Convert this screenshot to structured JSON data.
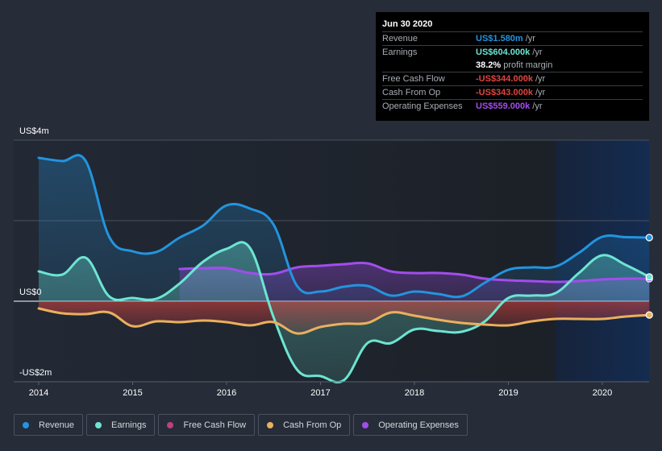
{
  "tooltip": {
    "date": "Jun 30 2020",
    "rows": [
      {
        "label": "Revenue",
        "value": "US$1.580m",
        "unit": "/yr",
        "color": "#2394df"
      },
      {
        "label": "Earnings",
        "value": "US$604.000k",
        "unit": "/yr",
        "color": "#6ce5d2"
      },
      {
        "label": "",
        "value": "38.2%",
        "unit": "profit margin",
        "color": "#ffffff"
      },
      {
        "label": "Free Cash Flow",
        "value": "-US$344.000k",
        "unit": "/yr",
        "color": "#e0453f"
      },
      {
        "label": "Cash From Op",
        "value": "-US$343.000k",
        "unit": "/yr",
        "color": "#e0453f"
      },
      {
        "label": "Operating Expenses",
        "value": "US$559.000k",
        "unit": "/yr",
        "color": "#a24ded"
      }
    ]
  },
  "legend": [
    {
      "label": "Revenue",
      "color": "#2394df"
    },
    {
      "label": "Earnings",
      "color": "#6ce5d2"
    },
    {
      "label": "Free Cash Flow",
      "color": "#c0407e"
    },
    {
      "label": "Cash From Op",
      "color": "#eab05e"
    },
    {
      "label": "Operating Expenses",
      "color": "#a24ded"
    }
  ],
  "chart_data": {
    "type": "area",
    "title": "",
    "xlabel": "",
    "ylabel": "",
    "y_unit": "US$ millions",
    "ylim": [
      -2,
      4
    ],
    "xlim": [
      2014.0,
      2020.5
    ],
    "y_tick_labels": [
      {
        "value": 4,
        "label": "US$4m"
      },
      {
        "value": 0,
        "label": "US$0"
      },
      {
        "value": -2,
        "label": "-US$2m"
      }
    ],
    "gridlines_at": [
      4,
      2,
      0
    ],
    "x_ticks": [
      {
        "value": 2014,
        "label": "2014"
      },
      {
        "value": 2015,
        "label": "2015"
      },
      {
        "value": 2016,
        "label": "2016"
      },
      {
        "value": 2017,
        "label": "2017"
      },
      {
        "value": 2018,
        "label": "2018"
      },
      {
        "value": 2019,
        "label": "2019"
      },
      {
        "value": 2020,
        "label": "2020"
      }
    ],
    "highlight_range": [
      2019.5,
      2020.5
    ],
    "legend_position": "bottom-left",
    "series": [
      {
        "name": "Revenue",
        "color": "#2394df",
        "fill": true,
        "x": [
          2014.0,
          2014.25,
          2014.5,
          2014.75,
          2015.0,
          2015.25,
          2015.5,
          2015.75,
          2016.0,
          2016.25,
          2016.5,
          2016.75,
          2017.0,
          2017.25,
          2017.5,
          2017.75,
          2018.0,
          2018.25,
          2018.5,
          2018.75,
          2019.0,
          2019.25,
          2019.5,
          2019.75,
          2020.0,
          2020.25,
          2020.5
        ],
        "values": [
          3.56,
          3.48,
          3.48,
          1.6,
          1.24,
          1.22,
          1.58,
          1.88,
          2.38,
          2.3,
          1.9,
          0.38,
          0.24,
          0.36,
          0.38,
          0.14,
          0.24,
          0.18,
          0.12,
          0.46,
          0.78,
          0.84,
          0.86,
          1.2,
          1.6,
          1.59,
          1.58
        ]
      },
      {
        "name": "Earnings",
        "color": "#6ce5d2",
        "fill": true,
        "x": [
          2014.0,
          2014.25,
          2014.5,
          2014.75,
          2015.0,
          2015.25,
          2015.5,
          2015.75,
          2016.0,
          2016.25,
          2016.5,
          2016.75,
          2017.0,
          2017.25,
          2017.5,
          2017.75,
          2018.0,
          2018.25,
          2018.5,
          2018.75,
          2019.0,
          2019.25,
          2019.5,
          2019.75,
          2020.0,
          2020.25,
          2020.5
        ],
        "values": [
          0.74,
          0.66,
          1.08,
          0.12,
          0.08,
          0.06,
          0.44,
          0.98,
          1.3,
          1.32,
          -0.4,
          -1.7,
          -1.86,
          -1.96,
          -1.04,
          -1.04,
          -0.7,
          -0.74,
          -0.76,
          -0.5,
          0.08,
          0.14,
          0.2,
          0.7,
          1.14,
          0.9,
          0.604
        ]
      },
      {
        "name": "Free Cash Flow",
        "color": "#c0407e",
        "fill": true,
        "x": [
          2014.0,
          2014.25,
          2014.5,
          2014.75,
          2015.0,
          2015.25,
          2015.5,
          2015.75,
          2016.0,
          2016.25,
          2016.5,
          2016.75,
          2017.0,
          2017.25,
          2017.5,
          2017.75,
          2018.0,
          2018.25,
          2018.5,
          2018.75,
          2019.0,
          2019.25,
          2019.5,
          2019.75,
          2020.0,
          2020.25,
          2020.5
        ],
        "values": [
          -0.18,
          -0.3,
          -0.32,
          -0.28,
          -0.62,
          -0.5,
          -0.52,
          -0.48,
          -0.52,
          -0.6,
          -0.52,
          -0.8,
          -0.64,
          -0.56,
          -0.54,
          -0.28,
          -0.36,
          -0.46,
          -0.54,
          -0.58,
          -0.6,
          -0.5,
          -0.44,
          -0.44,
          -0.44,
          -0.38,
          -0.344
        ]
      },
      {
        "name": "Cash From Op",
        "color": "#eab05e",
        "fill": false,
        "x": [
          2014.0,
          2014.25,
          2014.5,
          2014.75,
          2015.0,
          2015.25,
          2015.5,
          2015.75,
          2016.0,
          2016.25,
          2016.5,
          2016.75,
          2017.0,
          2017.25,
          2017.5,
          2017.75,
          2018.0,
          2018.25,
          2018.5,
          2018.75,
          2019.0,
          2019.25,
          2019.5,
          2019.75,
          2020.0,
          2020.25,
          2020.5
        ],
        "values": [
          -0.18,
          -0.3,
          -0.32,
          -0.28,
          -0.62,
          -0.5,
          -0.52,
          -0.48,
          -0.52,
          -0.6,
          -0.52,
          -0.8,
          -0.64,
          -0.56,
          -0.54,
          -0.28,
          -0.36,
          -0.46,
          -0.54,
          -0.58,
          -0.6,
          -0.5,
          -0.44,
          -0.44,
          -0.44,
          -0.38,
          -0.343
        ]
      },
      {
        "name": "Operating Expenses",
        "color": "#a24ded",
        "fill": true,
        "x": [
          2015.5,
          2015.75,
          2016.0,
          2016.25,
          2016.5,
          2016.75,
          2017.0,
          2017.25,
          2017.5,
          2017.75,
          2018.0,
          2018.25,
          2018.5,
          2018.75,
          2019.0,
          2019.25,
          2019.5,
          2019.75,
          2020.0,
          2020.25,
          2020.5
        ],
        "values": [
          0.8,
          0.82,
          0.82,
          0.7,
          0.68,
          0.84,
          0.88,
          0.92,
          0.94,
          0.74,
          0.7,
          0.7,
          0.66,
          0.56,
          0.52,
          0.5,
          0.48,
          0.5,
          0.54,
          0.56,
          0.559
        ]
      }
    ]
  }
}
